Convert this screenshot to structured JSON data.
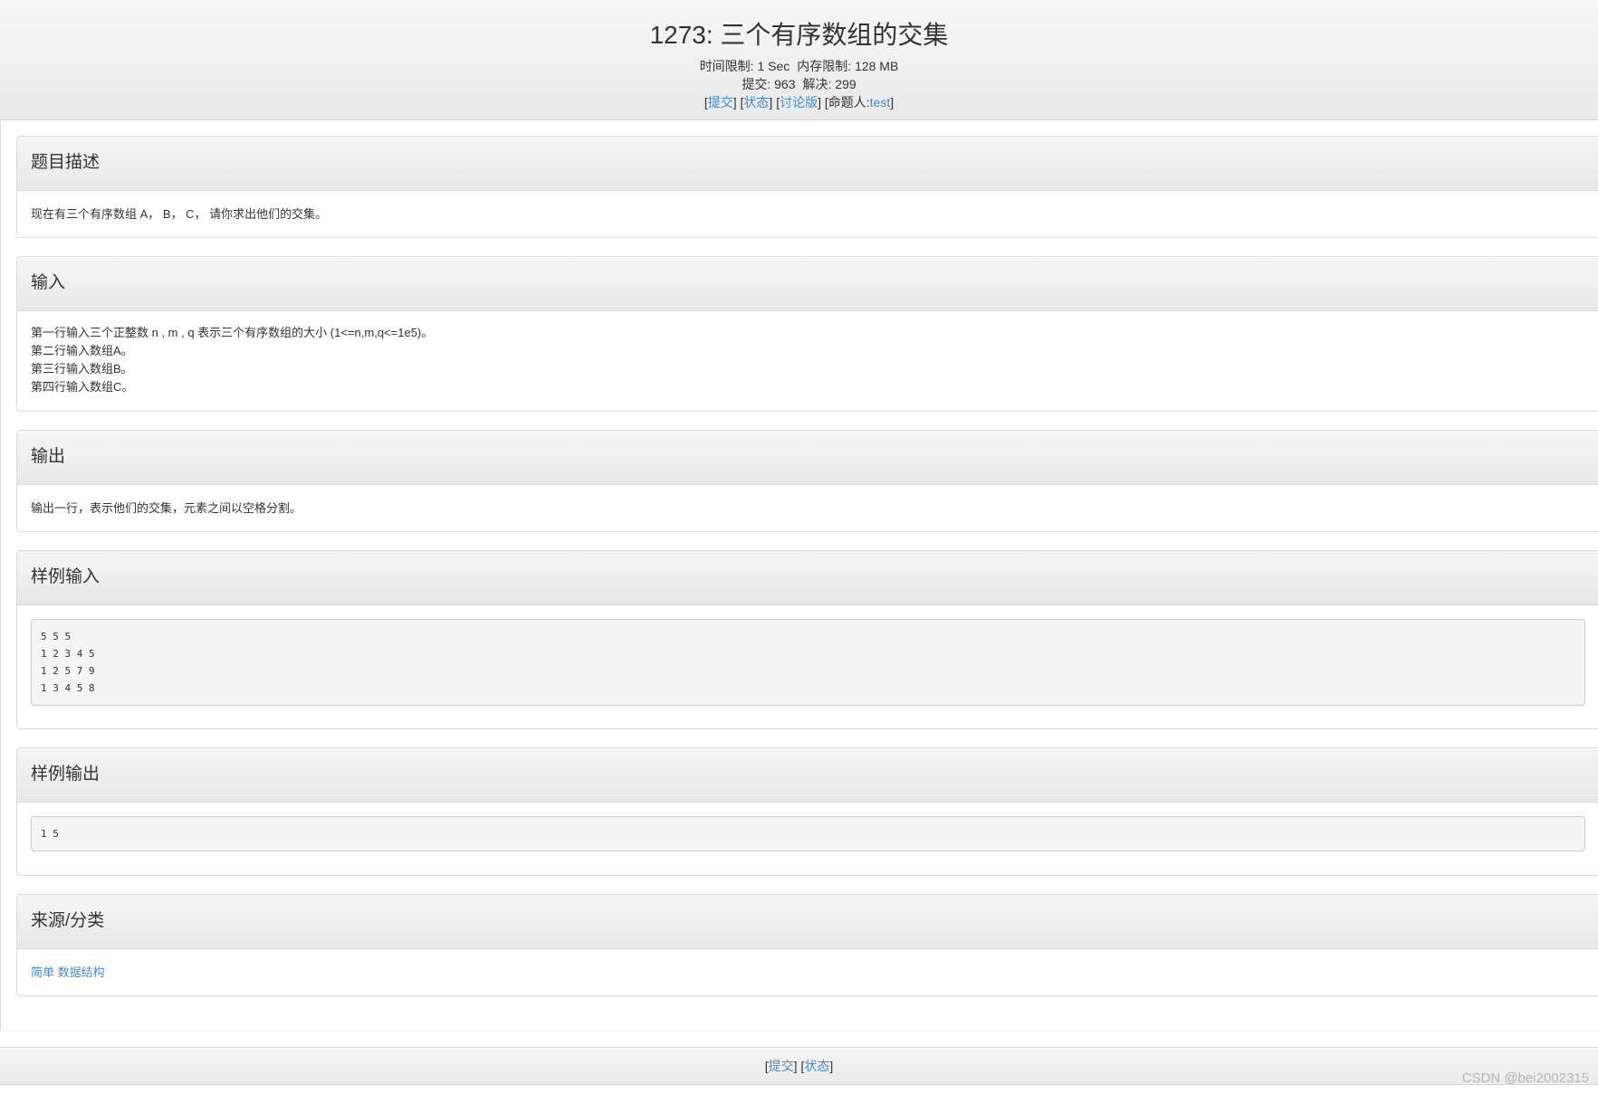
{
  "problem": {
    "title": "1273: 三个有序数组的交集",
    "time_limit_label": "时间限制:",
    "time_limit": "1 Sec",
    "memory_limit_label": "内存限制:",
    "memory_limit": "128 MB",
    "submit_count_label": "提交:",
    "submit_count": "963",
    "solved_label": "解决:",
    "solved_count": "299"
  },
  "header_links": {
    "submit": "提交",
    "status": "状态",
    "discuss": "讨论版",
    "author_label": "命题人:",
    "author": "test"
  },
  "sections": {
    "description": {
      "heading": "题目描述",
      "text": "现在有三个有序数组 A， B， C， 请你求出他们的交集。"
    },
    "input": {
      "heading": "输入",
      "lines": [
        "第一行输入三个正整数 n , m , q 表示三个有序数组的大小 (1<=n,m,q<=1e5)。",
        "第二行输入数组A。",
        "第三行输入数组B。",
        "第四行输入数组C。"
      ]
    },
    "output": {
      "heading": "输出",
      "text": "输出一行，表示他们的交集，元素之间以空格分割。"
    },
    "sample_input": {
      "heading": "样例输入",
      "lines": [
        "5 5 5",
        "1 2 3 4 5",
        "1 2 5 7 9",
        "1 3 4 5 8"
      ]
    },
    "sample_output": {
      "heading": "样例输出",
      "lines": [
        "1 5"
      ]
    },
    "source": {
      "heading": "来源/分类",
      "tags": [
        "简单",
        "数据结构"
      ]
    }
  },
  "footer_links": {
    "submit": "提交",
    "status": "状态"
  },
  "watermark": "CSDN @bei2002315",
  "colors": {
    "link": "#428bca",
    "text": "#333333",
    "panel_border": "#dcdcdc"
  }
}
